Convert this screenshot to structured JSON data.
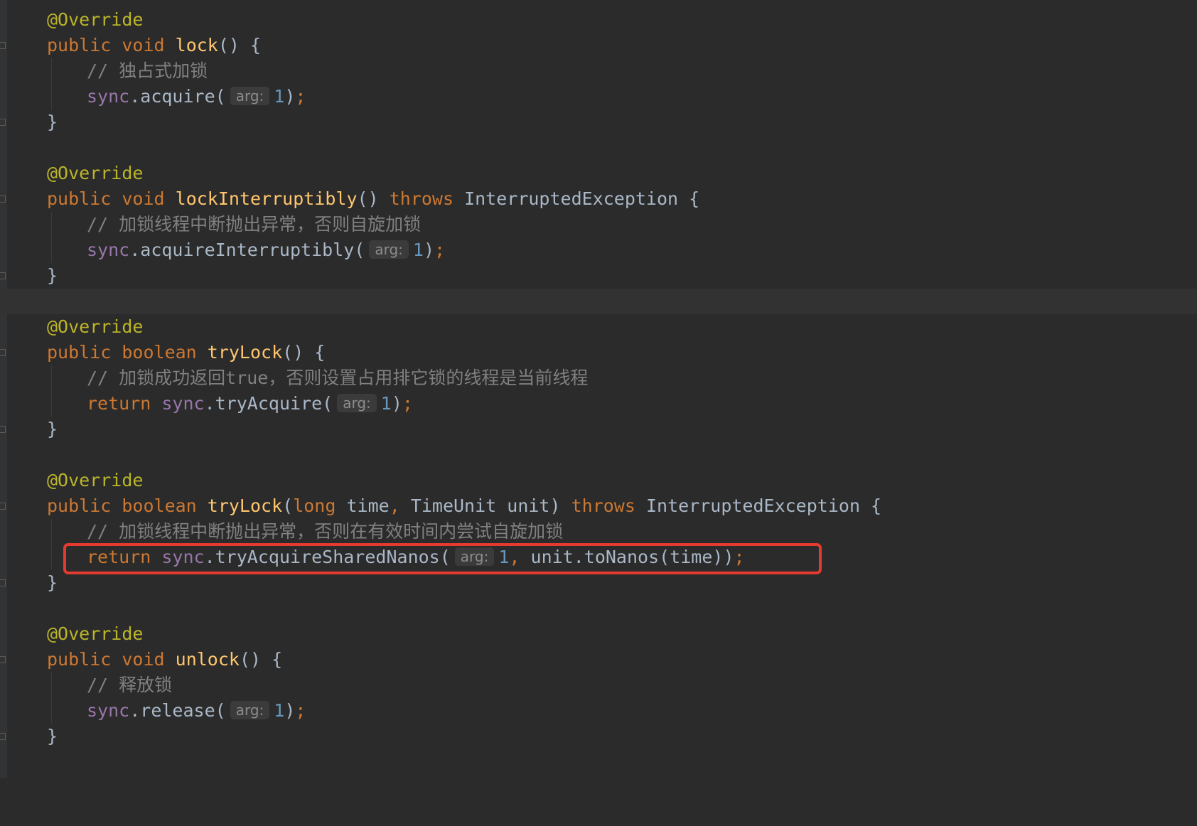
{
  "editor": {
    "colors": {
      "background": "#2b2b2b",
      "annotation": "#bbb529",
      "keyword": "#cc7832",
      "method_declaration": "#ffc66d",
      "field": "#9876aa",
      "number": "#6897bb",
      "plain": "#a9b7c6",
      "comment": "#808080",
      "highlight_box": "#e53a2f"
    },
    "methods": [
      {
        "annotation": "@Override",
        "modifiers": "public void",
        "name": "lock",
        "params_open": "() {",
        "comment": "// 独占式加锁",
        "call_field": "sync",
        "call_method": ".acquire(",
        "hint": "arg:",
        "arg": "1",
        "call_close": ")",
        "semicolon": ";",
        "close": "}"
      },
      {
        "annotation": "@Override",
        "modifiers": "public void",
        "name": "lockInterruptibly",
        "params_open": "()",
        "throws": "throws",
        "exception": "InterruptedException {",
        "comment": "// 加锁线程中断抛出异常，否则自旋加锁",
        "call_field": "sync",
        "call_method": ".acquireInterruptibly(",
        "hint": "arg:",
        "arg": "1",
        "call_close": ")",
        "semicolon": ";",
        "close": "}"
      },
      {
        "annotation": "@Override",
        "modifiers": "public boolean",
        "name": "tryLock",
        "params_open": "() {",
        "comment": "// 加锁成功返回true，否则设置占用排它锁的线程是当前线程",
        "return_kw": "return",
        "call_field": "sync",
        "call_method": ".tryAcquire(",
        "hint": "arg:",
        "arg": "1",
        "call_close": ")",
        "semicolon": ";",
        "close": "}"
      },
      {
        "annotation": "@Override",
        "modifiers": "public boolean",
        "name": "tryLock",
        "params_p1": "(",
        "param1_type": "long",
        "param1_name": " time",
        "comma": ",",
        "params_p2": " TimeUnit unit)",
        "throws": "throws",
        "exception": "InterruptedException {",
        "comment": "// 加锁线程中断抛出异常，否则在有效时间内尝试自旋加锁",
        "return_kw": "return",
        "call_field": "sync",
        "call_method": ".tryAcquireSharedNanos(",
        "hint": "arg:",
        "arg": "1",
        "call_rest": " unit.toNanos(time))",
        "semicolon": ";",
        "close": "}"
      },
      {
        "annotation": "@Override",
        "modifiers": "public void",
        "name": "unlock",
        "params_open": "() {",
        "comment": "// 释放锁",
        "call_field": "sync",
        "call_method": ".release(",
        "hint": "arg:",
        "arg": "1",
        "call_close": ")",
        "semicolon": ";",
        "close": "}"
      }
    ]
  }
}
